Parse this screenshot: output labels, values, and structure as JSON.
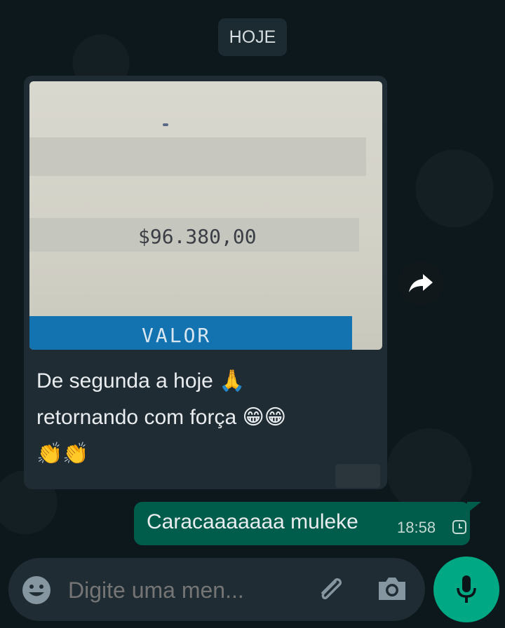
{
  "date_separator": "HOJE",
  "incoming": {
    "image": {
      "amount_text": "$96.380,00",
      "label_text": "VALOR"
    },
    "caption_line1": "De segunda a hoje 🙏",
    "caption_line2": "retornando com força 😁😁",
    "caption_line3": "👏👏"
  },
  "outgoing": {
    "text": "Caracaaaaaaa muleke",
    "time": "18:58",
    "status_icon": "clock-icon"
  },
  "composer": {
    "placeholder": "Digite uma men...",
    "emoji_icon": "smile-icon",
    "attach_icon": "paperclip-icon",
    "camera_icon": "camera-icon",
    "mic_icon": "mic-icon"
  },
  "colors": {
    "background": "#0b1418",
    "incoming_bubble": "#1f2c33",
    "outgoing_bubble": "#005c4b",
    "accent": "#00a884"
  }
}
